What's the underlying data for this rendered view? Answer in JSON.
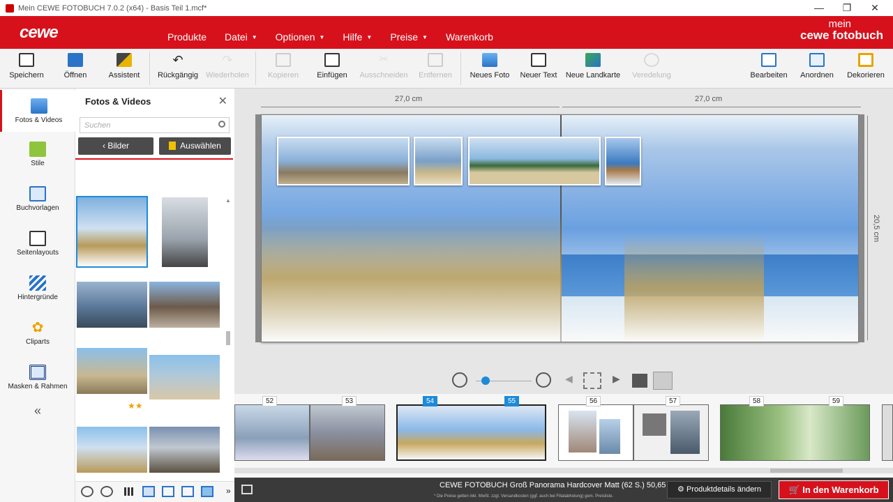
{
  "window": {
    "title": "Mein CEWE FOTOBUCH 7.0.2 (x64) - Basis Teil 1.mcf*"
  },
  "header": {
    "logo": "cewe",
    "brand_top": "mein",
    "brand_bottom": "cewe fotobuch",
    "menu": [
      "Produkte",
      "Datei",
      "Optionen",
      "Hilfe",
      "Preise",
      "Warenkorb"
    ]
  },
  "toolbar": {
    "items": [
      "Speichern",
      "Öffnen",
      "Assistent",
      "Rückgängig",
      "Wiederholen",
      "Kopieren",
      "Einfügen",
      "Ausschneiden",
      "Entfernen",
      "Neues Foto",
      "Neuer Text",
      "Neue Landkarte",
      "Veredelung",
      "Bearbeiten",
      "Anordnen",
      "Dekorieren"
    ]
  },
  "leftnav": {
    "items": [
      "Fotos & Videos",
      "Stile",
      "Buchvorlagen",
      "Seitenlayouts",
      "Hintergründe",
      "Cliparts",
      "Masken & Rahmen"
    ],
    "collapse": "«"
  },
  "panel": {
    "title": "Fotos & Videos",
    "close": "✕",
    "search_placeholder": "Suchen",
    "btn_bilder": "Bilder",
    "btn_auswaehlen": "Auswählen",
    "rating": "★★"
  },
  "workspace": {
    "width_left": "27,0 cm",
    "width_right": "27,0 cm",
    "height": "20,5 cm"
  },
  "filmstrip": {
    "pages": [
      "52",
      "53",
      "54",
      "55",
      "56",
      "57",
      "58",
      "59"
    ]
  },
  "bottom": {
    "product": "CEWE FOTOBUCH Groß Panorama Hardcover Matt (62 S.) 50,65 €*",
    "note": "* Die Preise gelten inkl. MwSt. zzgl. Versandkosten (ggf. auch bei Filialabholung) gem. Preisliste.",
    "details_btn": "Produktdetails ändern",
    "cart_btn": "In den Warenkorb"
  },
  "colors": {
    "accent": "#d7111c",
    "selected": "#1c8ad8"
  }
}
